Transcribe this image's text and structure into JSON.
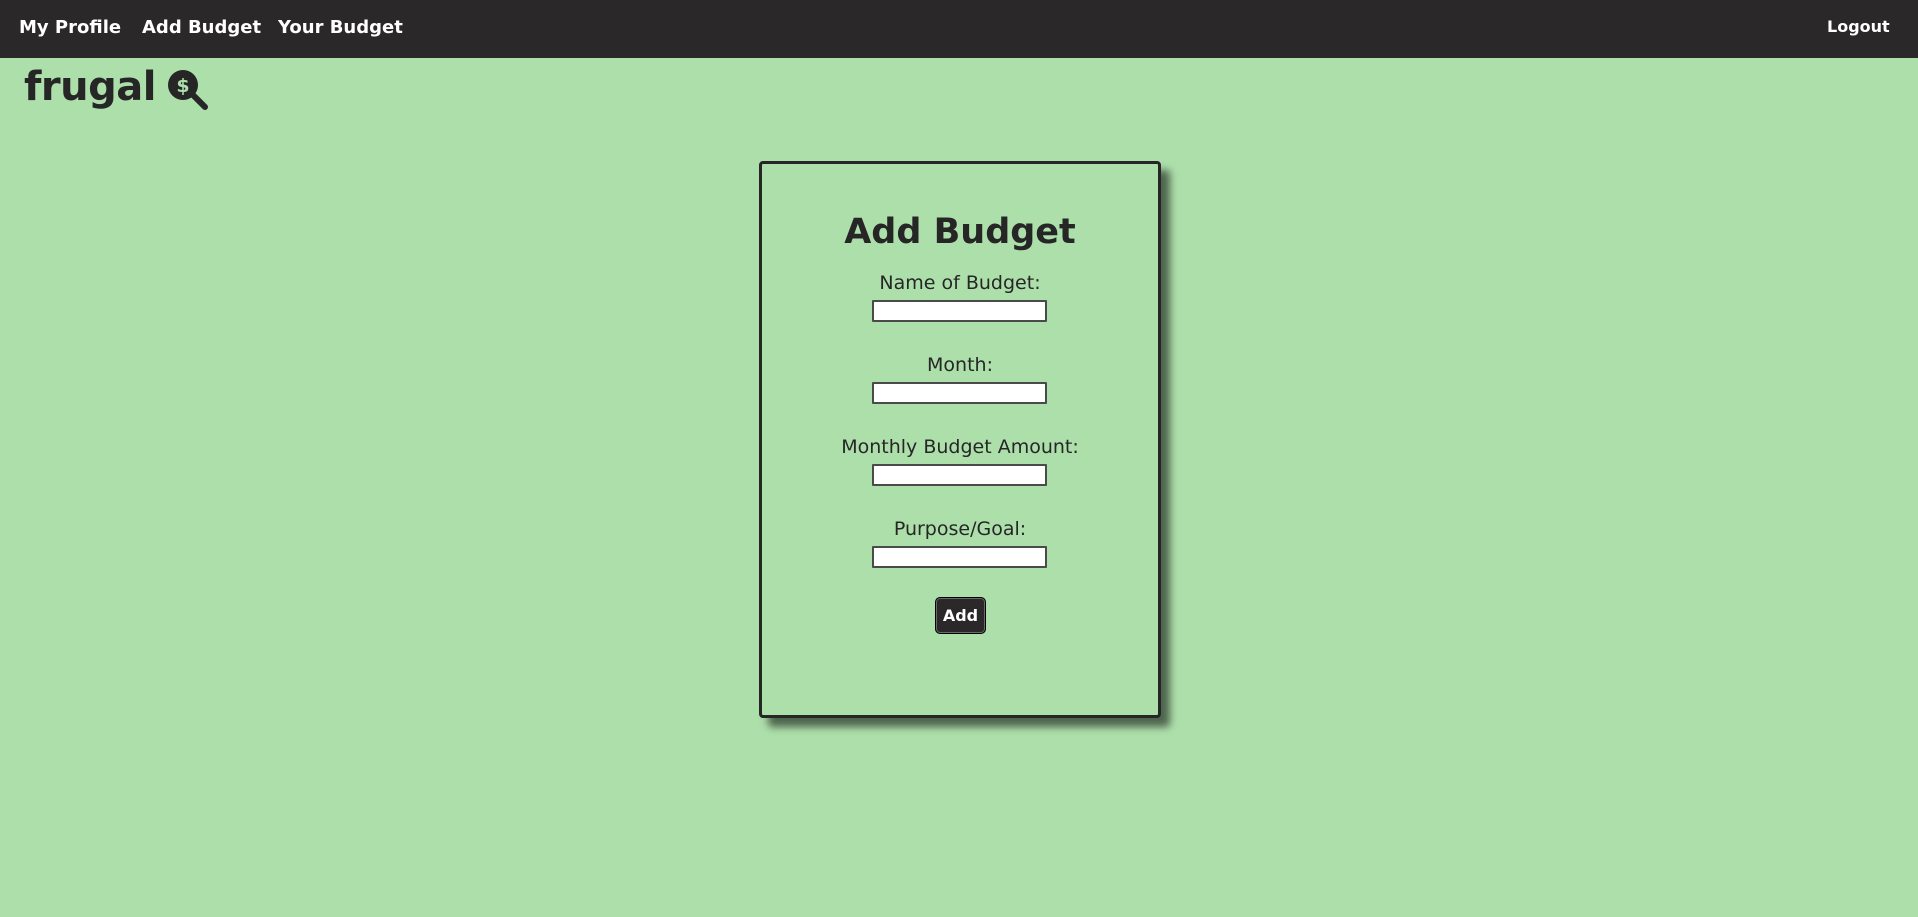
{
  "nav": {
    "my_profile": "My Profile",
    "add_budget": "Add Budget",
    "your_budget": "Your Budget",
    "logout": "Logout"
  },
  "logo": {
    "text": "frugal",
    "icon": "magnifier-dollar-icon"
  },
  "form": {
    "title": "Add Budget",
    "fields": [
      {
        "label": "Name of Budget:",
        "value": ""
      },
      {
        "label": "Month:",
        "value": ""
      },
      {
        "label": "Monthly Budget Amount:",
        "value": ""
      },
      {
        "label": "Purpose/Goal:",
        "value": ""
      }
    ],
    "submit_label": "Add"
  },
  "colors": {
    "background": "#addfab",
    "navbar": "#2a2829",
    "text": "#262626"
  }
}
